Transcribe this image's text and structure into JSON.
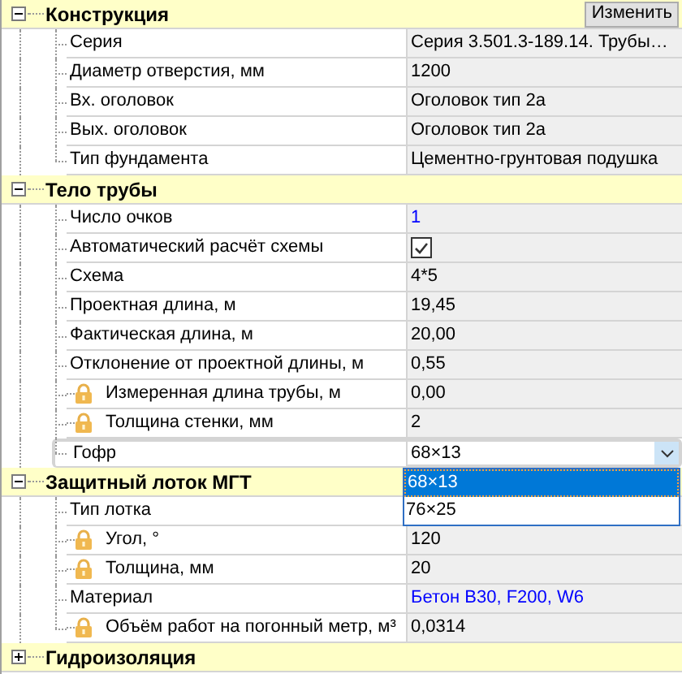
{
  "sections": [
    {
      "title": "Конструкция",
      "expanded": true,
      "button": "Изменить",
      "rows": [
        {
          "kind": "text",
          "label": "Серия",
          "value": "Серия 3.501.3-189.14. Трубы…",
          "locked": false
        },
        {
          "kind": "text",
          "label": "Диаметр отверстия, мм",
          "value": "1200",
          "locked": false
        },
        {
          "kind": "text",
          "label": "Вх. оголовок",
          "value": "Оголовок тип 2а",
          "locked": false
        },
        {
          "kind": "text",
          "label": "Вых. оголовок",
          "value": "Оголовок тип 2а",
          "locked": false
        },
        {
          "kind": "text",
          "label": "Тип фундамента",
          "value": "Цементно-грунтовая подушка",
          "locked": false
        }
      ]
    },
    {
      "title": "Тело трубы",
      "expanded": true,
      "rows": [
        {
          "kind": "link",
          "label": "Число очков",
          "value": "1",
          "locked": false
        },
        {
          "kind": "checkbox",
          "label": "Автоматический расчёт схемы",
          "checked": true,
          "locked": false
        },
        {
          "kind": "text",
          "label": "Схема",
          "value": "4*5",
          "locked": false
        },
        {
          "kind": "text",
          "label": "Проектная длина, м",
          "value": "19,45",
          "locked": false
        },
        {
          "kind": "text",
          "label": "Фактическая длина, м",
          "value": "20,00",
          "locked": false
        },
        {
          "kind": "text",
          "label": "Отклонение от проектной длины, м",
          "value": "0,55",
          "locked": false
        },
        {
          "kind": "text",
          "label": "Измеренная длина трубы, м",
          "value": "0,00",
          "locked": true
        },
        {
          "kind": "text",
          "label": "Толщина стенки, мм",
          "value": "2",
          "locked": true
        },
        {
          "kind": "combo",
          "label": "Гофр",
          "value": "68×13",
          "locked": false,
          "expanded": true,
          "options": [
            {
              "label": "68×13",
              "selected": true
            },
            {
              "label": "76×25",
              "selected": false
            }
          ]
        }
      ]
    },
    {
      "title": "Защитный лоток МГТ",
      "expanded": true,
      "rows": [
        {
          "kind": "text",
          "label": "Тип лотка",
          "locked": false
        },
        {
          "kind": "text",
          "label": "Угол, °",
          "value": "120",
          "locked": true
        },
        {
          "kind": "text",
          "label": "Толщина, мм",
          "value": "20",
          "locked": true
        },
        {
          "kind": "link",
          "label": "Материал",
          "value": "Бетон B30, F200, W6",
          "locked": false
        },
        {
          "kind": "text",
          "label": "Объём работ на погонный метр, м³",
          "value": "0,0314",
          "locked": true
        }
      ]
    },
    {
      "title": "Гидроизоляция",
      "expanded": false
    }
  ]
}
